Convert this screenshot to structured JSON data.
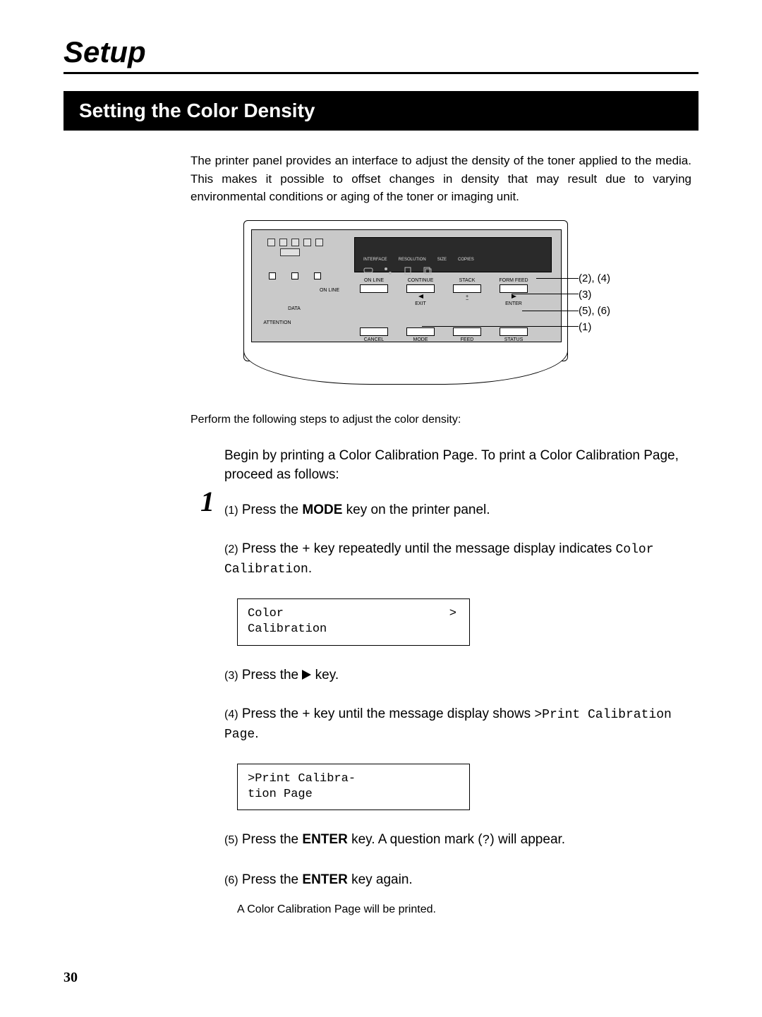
{
  "header": "Setup",
  "section_title": "Setting the Color Density",
  "intro": "The printer panel provides an interface to adjust the density of the toner applied to the media. This makes it possible to offset changes in density that may result due to varying environmental conditions or aging of the toner or imaging unit.",
  "diagram": {
    "lcd_labels": [
      "INTERFACE",
      "RESOLUTION",
      "SIZE",
      "COPIES"
    ],
    "left_labels": {
      "online": "ON LINE",
      "data": "DATA",
      "attention": "ATTENTION"
    },
    "row1": {
      "b1": "ON LINE",
      "b2": "CONTINUE",
      "b3": "STACK",
      "b4": "FORM FEED"
    },
    "row1_under": {
      "u2": "EXIT",
      "u3_top": "+",
      "u3_bot": "−",
      "u4": "ENTER"
    },
    "row2": {
      "b1": "CANCEL",
      "b2": "MODE",
      "b3": "FEED",
      "b4": "STATUS"
    },
    "callouts": {
      "c1": "(2), (4)",
      "c2": "(3)",
      "c3": "(5), (6)",
      "c4": "(1)"
    }
  },
  "perform": "Perform the following steps to adjust the color density:",
  "step_number": "1",
  "step": {
    "intro": "Begin by printing a Color Calibration Page. To print a Color Calibration Page, proceed as follows:",
    "s1_num": "(1)",
    "s1_a": "Press the ",
    "s1_b": "MODE",
    "s1_c": " key on the printer panel.",
    "s2_num": "(2)",
    "s2_a": "Press the + key repeatedly until the message display indicates ",
    "s2_b": "Color Calibration",
    "s2_c": ".",
    "disp1_l1": "Color",
    "disp1_gt": ">",
    "disp1_l2": "Calibration",
    "s3_num": "(3)",
    "s3_a": "Press the ",
    "s3_b": " key.",
    "s4_num": "(4)",
    "s4_a": "Press the + key until the message display shows ",
    "s4_b": ">Print Calibration Page",
    "s4_c": ".",
    "disp2_l1": ">Print Calibra-",
    "disp2_l2": "tion Page",
    "s5_num": "(5)",
    "s5_a": "Press the ",
    "s5_b": "ENTER",
    "s5_c": " key. A question mark (",
    "s5_d": "?",
    "s5_e": ") will appear.",
    "s6_num": "(6)",
    "s6_a": "Press the ",
    "s6_b": "ENTER",
    "s6_c": " key again.",
    "result": "A Color Calibration Page will be printed."
  },
  "page_number": "30"
}
